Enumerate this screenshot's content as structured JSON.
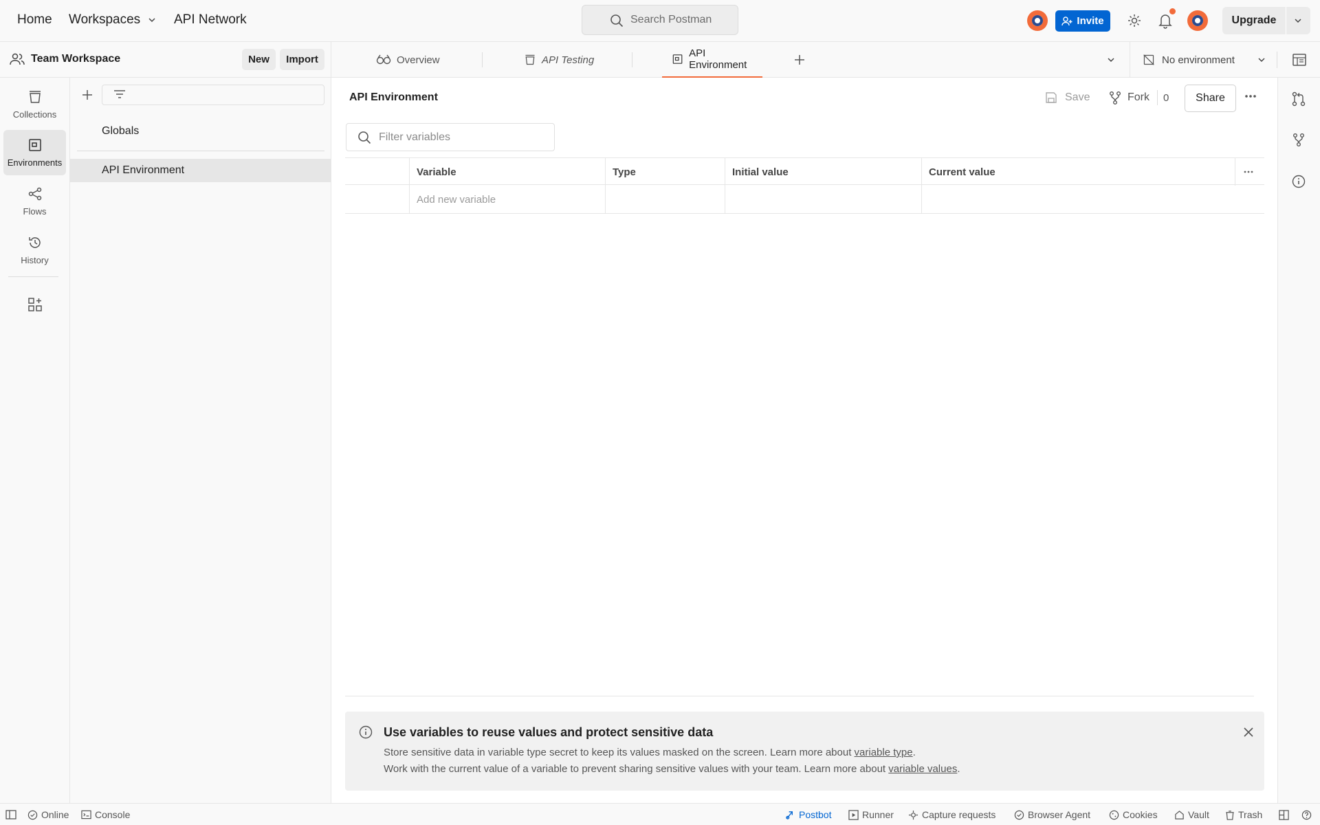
{
  "topnav": {
    "home": "Home",
    "workspaces": "Workspaces",
    "api_network": "API Network",
    "search_placeholder": "Search Postman",
    "invite": "Invite",
    "upgrade": "Upgrade"
  },
  "workspace": {
    "name": "Team Workspace",
    "new": "New",
    "import": "Import"
  },
  "rail": {
    "items": [
      {
        "label": "Collections",
        "icon": "collections-icon"
      },
      {
        "label": "Environments",
        "icon": "environments-icon"
      },
      {
        "label": "Flows",
        "icon": "flows-icon"
      },
      {
        "label": "History",
        "icon": "history-icon"
      }
    ]
  },
  "sidebar": {
    "items": [
      {
        "label": "Globals"
      },
      {
        "label": "API Environment"
      }
    ]
  },
  "tabs": {
    "items": [
      {
        "label": "Overview"
      },
      {
        "label": "API Testing"
      },
      {
        "label": "API Environment"
      }
    ],
    "environment_select": "No environment"
  },
  "editor": {
    "title": "API Environment",
    "save": "Save",
    "fork": "Fork",
    "fork_count": "0",
    "share": "Share",
    "filter_placeholder": "Filter variables",
    "columns": [
      "Variable",
      "Type",
      "Initial value",
      "Current value"
    ],
    "add_placeholder": "Add new variable"
  },
  "banner": {
    "title": "Use variables to reuse values and protect sensitive data",
    "line1_pre": "Store sensitive data in variable type secret to keep its values masked on the screen. Learn more about ",
    "line1_link": "variable type",
    "line1_post": ".",
    "line2_pre": "Work with the current value of a variable to prevent sharing sensitive values with your team. Learn more about ",
    "line2_link": "variable values",
    "line2_post": "."
  },
  "statusbar": {
    "online": "Online",
    "console": "Console",
    "postbot": "Postbot",
    "runner": "Runner",
    "capture": "Capture requests",
    "browser_agent": "Browser Agent",
    "cookies": "Cookies",
    "vault": "Vault",
    "trash": "Trash"
  },
  "colors": {
    "accent": "#0265d2",
    "active_tab_underline": "#f26b3a",
    "notification_dot": "#f26b3a"
  }
}
